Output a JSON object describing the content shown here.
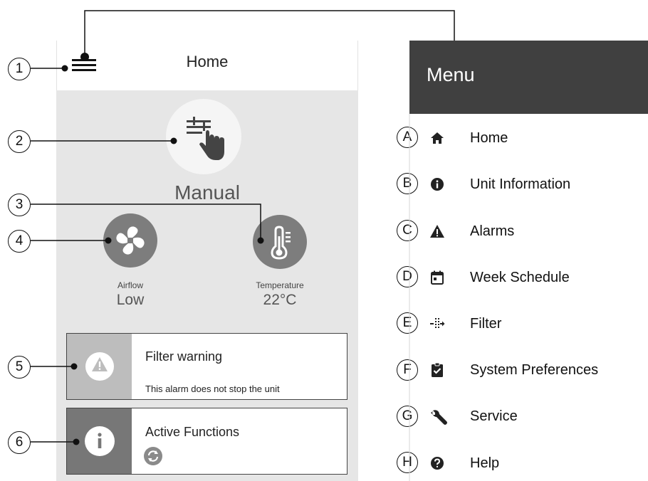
{
  "screen": {
    "header_title": "Home",
    "mode_label": "Manual",
    "airflow": {
      "label": "Airflow",
      "value": "Low"
    },
    "temperature": {
      "label": "Temperature",
      "value": "22°C"
    },
    "filter_card": {
      "title": "Filter warning",
      "subtitle": "This alarm does not stop the unit"
    },
    "active_card": {
      "title": "Active Functions"
    }
  },
  "menu": {
    "title": "Menu",
    "items": [
      {
        "letter": "A",
        "label": "Home",
        "icon": "home-icon"
      },
      {
        "letter": "B",
        "label": "Unit Information",
        "icon": "info-icon"
      },
      {
        "letter": "C",
        "label": "Alarms",
        "icon": "warning-icon"
      },
      {
        "letter": "D",
        "label": "Week Schedule",
        "icon": "calendar-icon"
      },
      {
        "letter": "E",
        "label": "Filter",
        "icon": "filter-icon"
      },
      {
        "letter": "F",
        "label": "System Preferences",
        "icon": "clipboard-check-icon"
      },
      {
        "letter": "G",
        "label": "Service",
        "icon": "wrench-icon"
      },
      {
        "letter": "H",
        "label": "Help",
        "icon": "help-icon"
      }
    ]
  },
  "callouts": [
    "1",
    "2",
    "3",
    "4",
    "5",
    "6"
  ],
  "colors": {
    "menu_header": "#404040",
    "screen_body": "#e6e6e6",
    "icon_circle": "#7d7d7d",
    "filter_side": "#bdbdbd",
    "active_side": "#777777"
  }
}
